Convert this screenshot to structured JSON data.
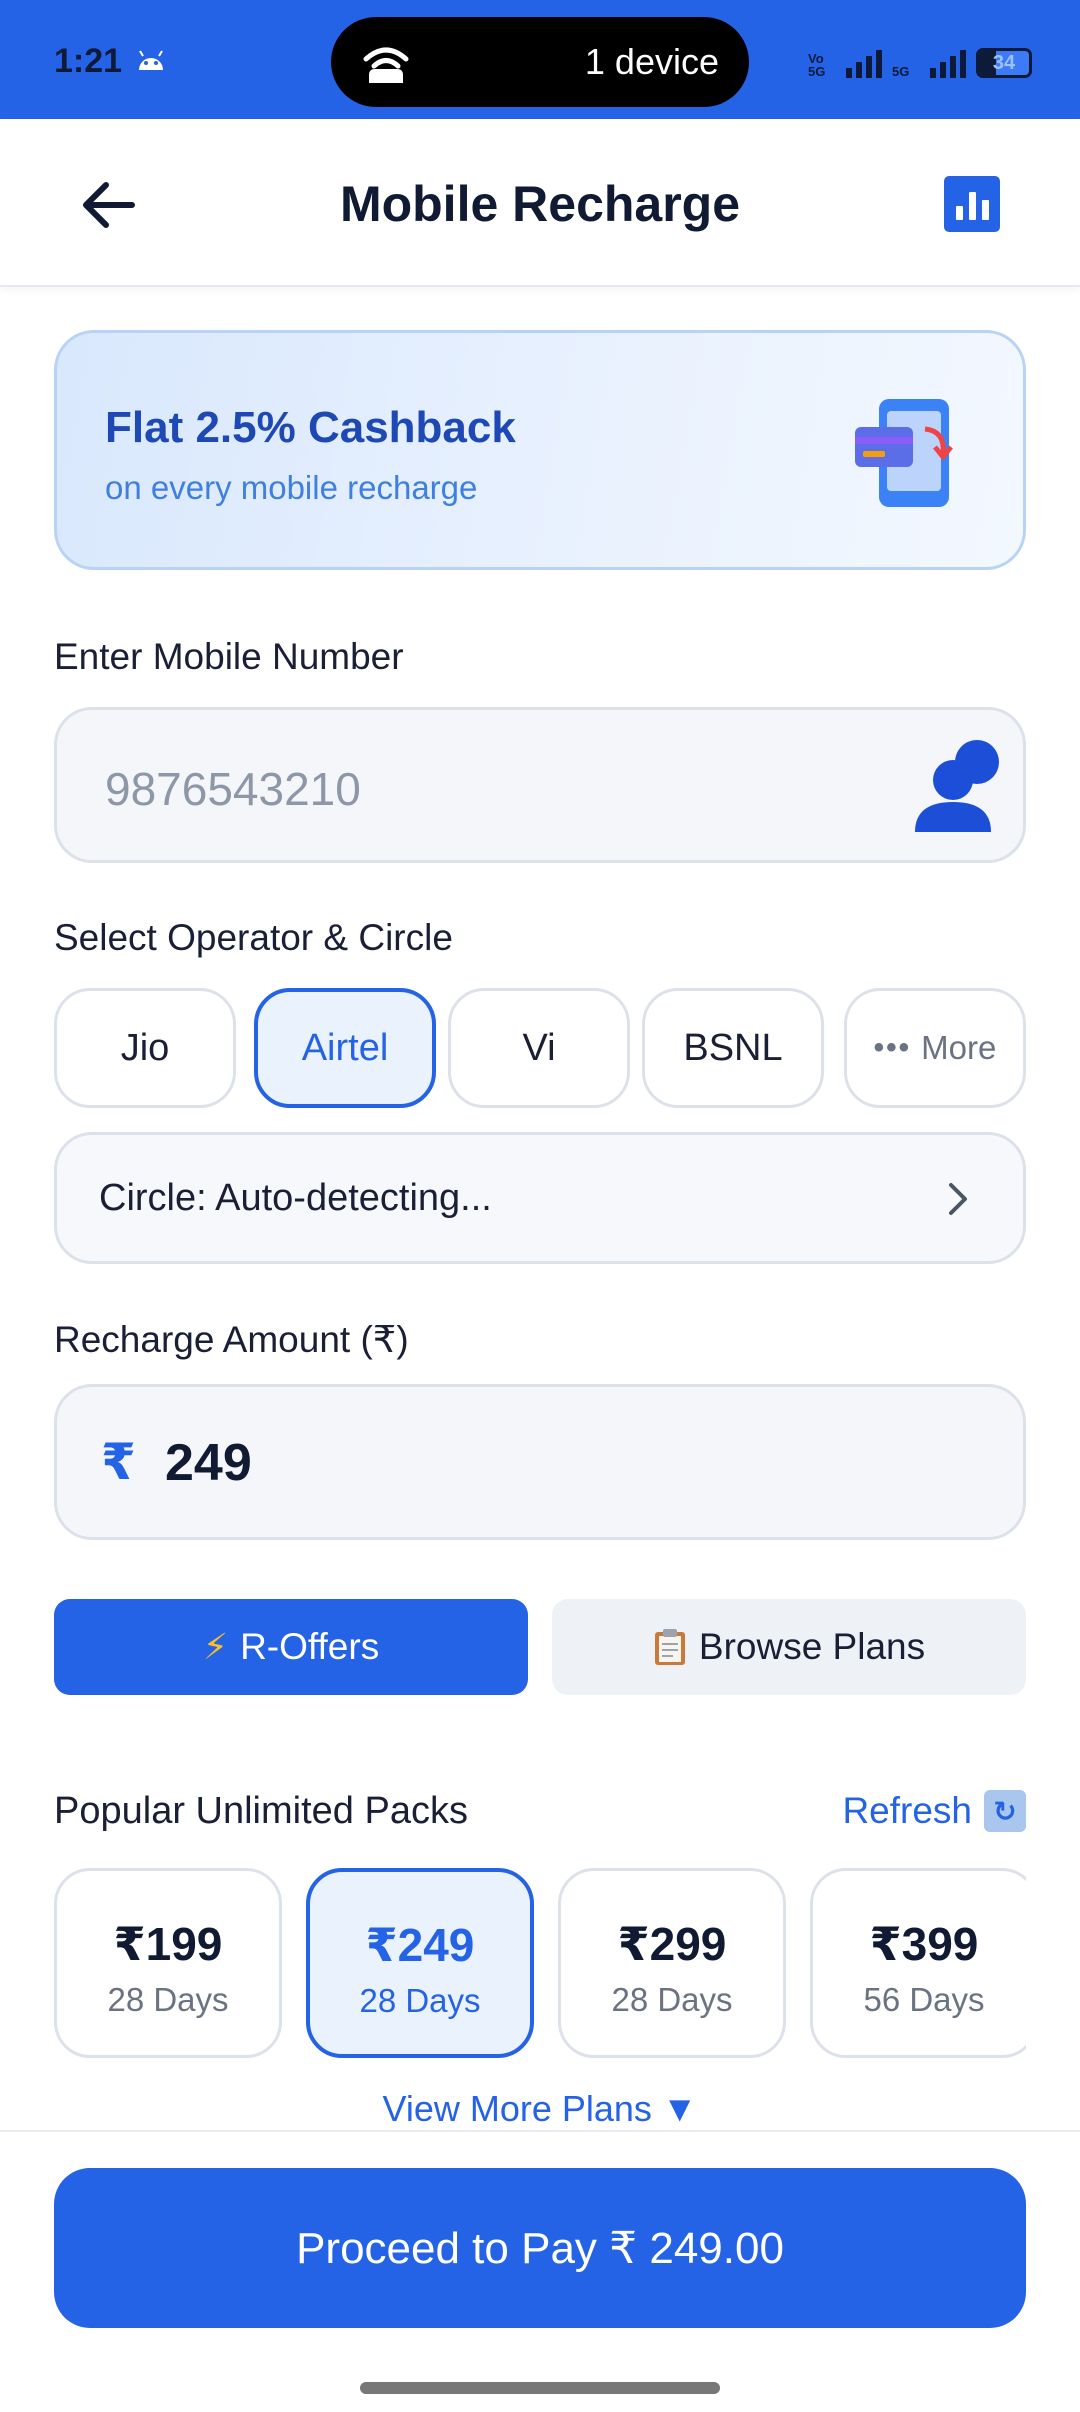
{
  "status_bar": {
    "time": "1:21",
    "pill_text": "1 device",
    "battery": "34",
    "battery_level": 0.34,
    "sim1_label": "Vo 5G",
    "sim2_label": "5G"
  },
  "header": {
    "title": "Mobile Recharge"
  },
  "banner": {
    "title": "Flat 2.5% Cashback",
    "subtitle": "on every mobile recharge"
  },
  "mobile": {
    "label": "Enter Mobile Number",
    "placeholder": "9876543210"
  },
  "operator": {
    "label": "Select Operator & Circle",
    "options": [
      "Jio",
      "Airtel",
      "Vi",
      "BSNL"
    ],
    "selected": "Airtel",
    "more_label": "More",
    "circle_text": "Circle: Auto-detecting..."
  },
  "amount": {
    "label": "Recharge Amount (₹)",
    "currency": "₹",
    "value": "249"
  },
  "actions": {
    "r_offers": "R-Offers",
    "browse_plans": "Browse Plans"
  },
  "packs": {
    "title": "Popular Unlimited Packs",
    "refresh": "Refresh",
    "items": [
      {
        "price": "₹199",
        "days": "28 Days"
      },
      {
        "price": "₹249",
        "days": "28 Days"
      },
      {
        "price": "₹299",
        "days": "28 Days"
      },
      {
        "price": "₹399",
        "days": "56 Days"
      }
    ],
    "selected_index": 1,
    "view_more": "View More Plans ▼"
  },
  "footer": {
    "pay_button": "Proceed to Pay ₹ 249.00"
  },
  "colors": {
    "accent": "#2563e6",
    "status_bar": "#2563e6",
    "banner_bg": "#e3eefd"
  }
}
